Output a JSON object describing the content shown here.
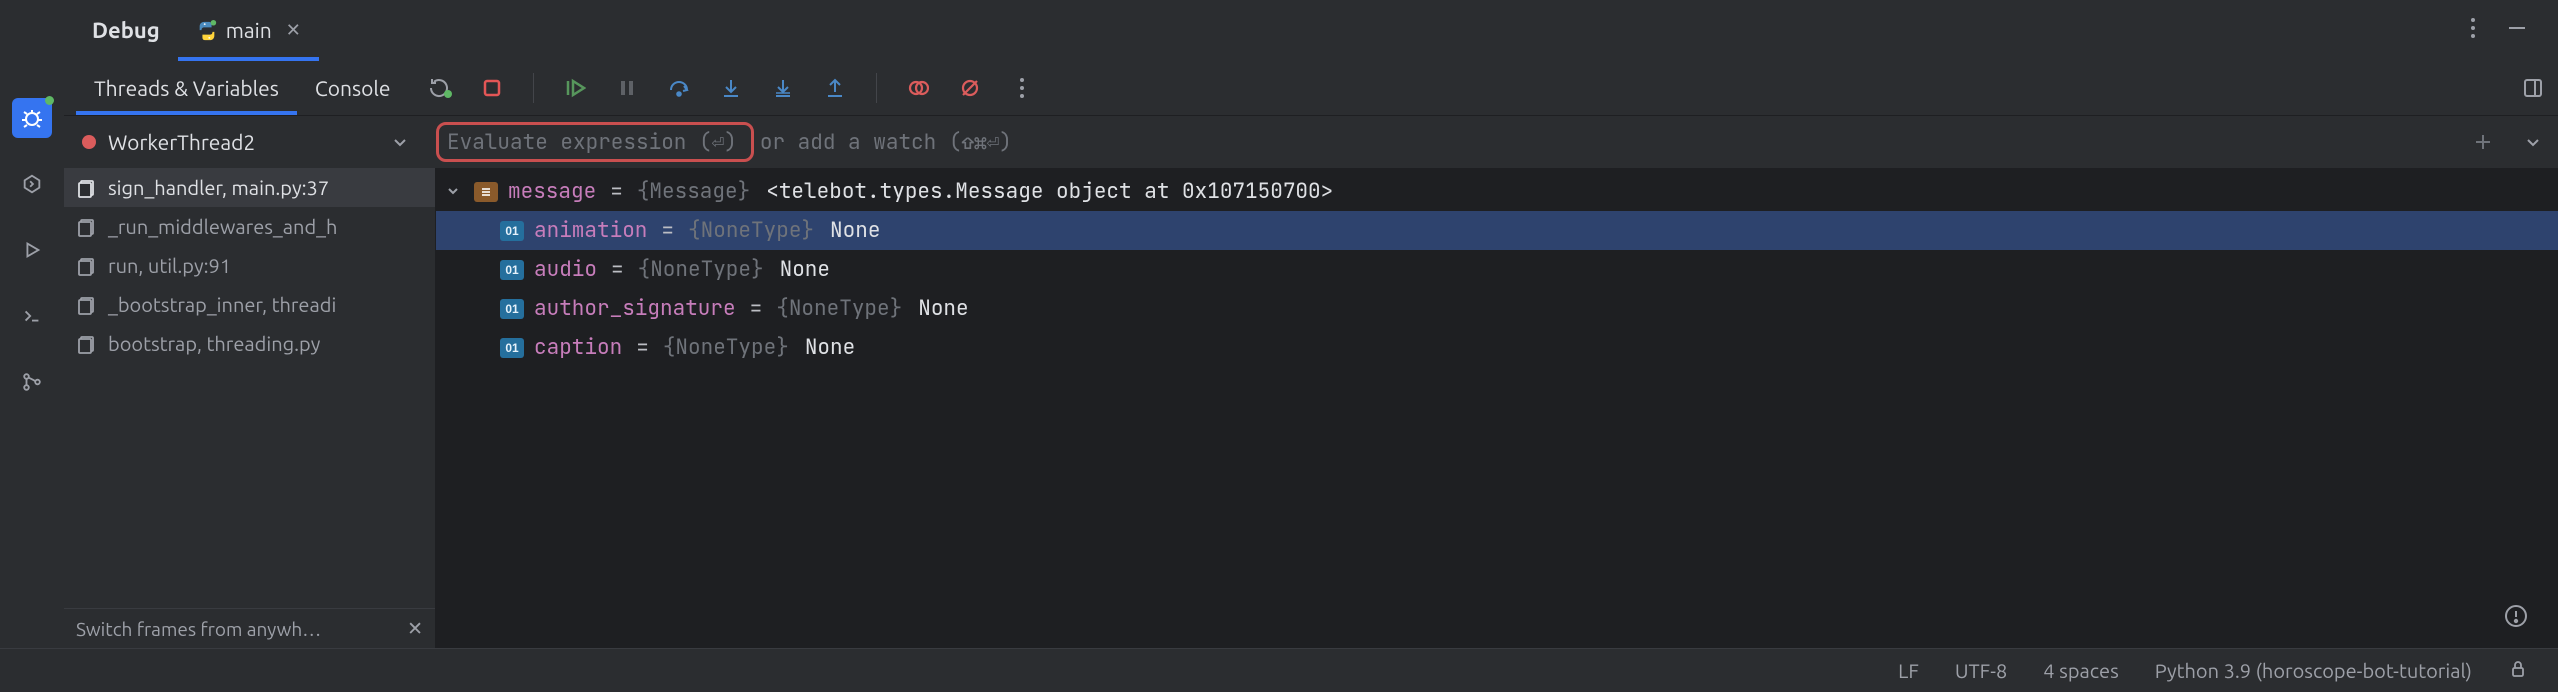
{
  "tabs": {
    "debug_label": "Debug",
    "file_label": "main"
  },
  "subTabs": {
    "threads_vars": "Threads & Variables",
    "console": "Console"
  },
  "thread": {
    "name": "WorkerThread2"
  },
  "evaluate": {
    "highlight": "Evaluate expression (⏎)",
    "rest": " or add a watch (⇧⌘⏎)"
  },
  "frames": [
    {
      "label": "sign_handler, main.py:37",
      "selected": true
    },
    {
      "label": "_run_middlewares_and_h",
      "selected": false
    },
    {
      "label": "run, util.py:91",
      "selected": false
    },
    {
      "label": "_bootstrap_inner, threadi",
      "selected": false
    },
    {
      "label": "bootstrap, threading.py",
      "selected": false
    }
  ],
  "tip": {
    "text": "Switch frames from anywh…"
  },
  "vars": {
    "root": {
      "name": "message",
      "type": "{Message}",
      "value": "<telebot.types.Message object at 0x107150700>"
    },
    "children": [
      {
        "name": "animation",
        "type": "{NoneType}",
        "value": "None",
        "selected": true
      },
      {
        "name": "audio",
        "type": "{NoneType}",
        "value": "None"
      },
      {
        "name": "author_signature",
        "type": "{NoneType}",
        "value": "None"
      },
      {
        "name": "caption",
        "type": "{NoneType}",
        "value": "None"
      }
    ]
  },
  "status": {
    "eol": "LF",
    "encoding": "UTF-8",
    "indent": "4 spaces",
    "interpreter": "Python 3.9 (horoscope-bot-tutorial)"
  }
}
